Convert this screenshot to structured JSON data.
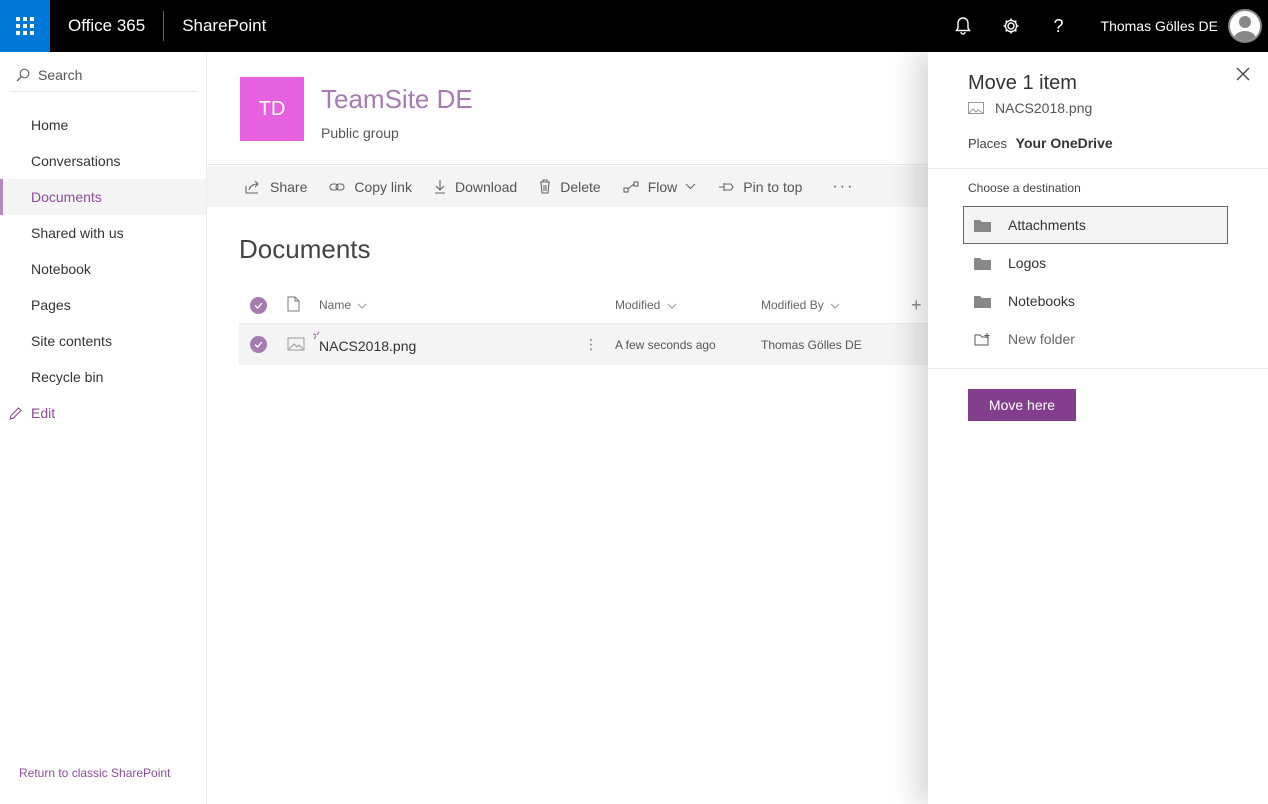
{
  "suitebar": {
    "brand": "Office 365",
    "app": "SharePoint",
    "user_name": "Thomas Gölles DE",
    "help_glyph": "?"
  },
  "leftnav": {
    "search_label": "Search",
    "items": [
      {
        "label": "Home"
      },
      {
        "label": "Conversations"
      },
      {
        "label": "Documents"
      },
      {
        "label": "Shared with us"
      },
      {
        "label": "Notebook"
      },
      {
        "label": "Pages"
      },
      {
        "label": "Site contents"
      },
      {
        "label": "Recycle bin"
      }
    ],
    "selected_index": 2,
    "edit_label": "Edit",
    "return_link": "Return to classic SharePoint"
  },
  "site": {
    "logo_initials": "TD",
    "logo_color": "#e660e0",
    "title": "TeamSite DE",
    "subtitle": "Public group"
  },
  "commands": {
    "share": "Share",
    "copy_link": "Copy link",
    "download": "Download",
    "delete": "Delete",
    "flow": "Flow",
    "pin": "Pin to top",
    "more": "···"
  },
  "library": {
    "title": "Documents",
    "columns": {
      "name": "Name",
      "modified": "Modified",
      "modified_by": "Modified By",
      "add": "+"
    },
    "rows": [
      {
        "name": "NACS2018.png",
        "modified": "A few seconds ago",
        "modified_by": "Thomas Gölles DE",
        "more": "⋮"
      }
    ]
  },
  "panel": {
    "title": "Move 1 item",
    "file_name": "NACS2018.png",
    "places_label": "Places",
    "places_value": "Your OneDrive",
    "choose_label": "Choose a destination",
    "destinations": [
      {
        "label": "Attachments"
      },
      {
        "label": "Logos"
      },
      {
        "label": "Notebooks"
      }
    ],
    "selected_index": 0,
    "new_folder_label": "New folder",
    "move_button": "Move here"
  },
  "colors": {
    "accent": "#833f8e",
    "accent_light": "#a67bb2",
    "waffle": "#0078d7"
  }
}
